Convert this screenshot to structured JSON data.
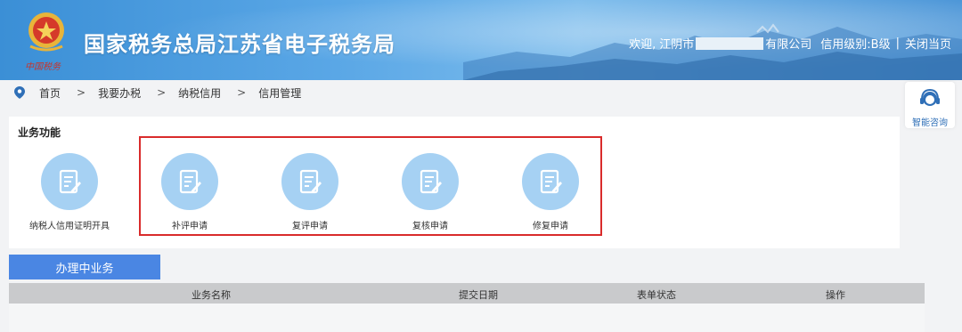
{
  "header": {
    "title": "国家税务总局江苏省电子税务局",
    "emblem_text": "中国税务",
    "welcome": "欢迎,",
    "company_prefix": "江阴市",
    "company_suffix": "有限公司",
    "credit_level": "信用级别:B级",
    "separator": "|",
    "close_page": "关闭当页",
    "colors": {
      "sky": "#4e97d8",
      "text": "#ffffff"
    }
  },
  "breadcrumb": {
    "icon": "location-pin-icon",
    "items": [
      "首页",
      "我要办税",
      "纳税信用",
      "信用管理"
    ],
    "arrow": ">"
  },
  "consult": {
    "label": "智能咨询",
    "icon": "headset-agent-icon"
  },
  "functions": {
    "title": "业务功能",
    "items": [
      {
        "label": "纳税人信用证明开具",
        "icon": "document-edit-icon"
      },
      {
        "label": "补评申请",
        "icon": "document-edit-icon"
      },
      {
        "label": "复评申请",
        "icon": "document-edit-icon"
      },
      {
        "label": "复核申请",
        "icon": "document-edit-icon"
      },
      {
        "label": "修复申请",
        "icon": "document-edit-icon"
      }
    ],
    "highlight_color": "#d92b2b"
  },
  "tabs": {
    "active": "办理中业务"
  },
  "table": {
    "columns": [
      "业务名称",
      "提交日期",
      "表单状态",
      "操作"
    ]
  }
}
